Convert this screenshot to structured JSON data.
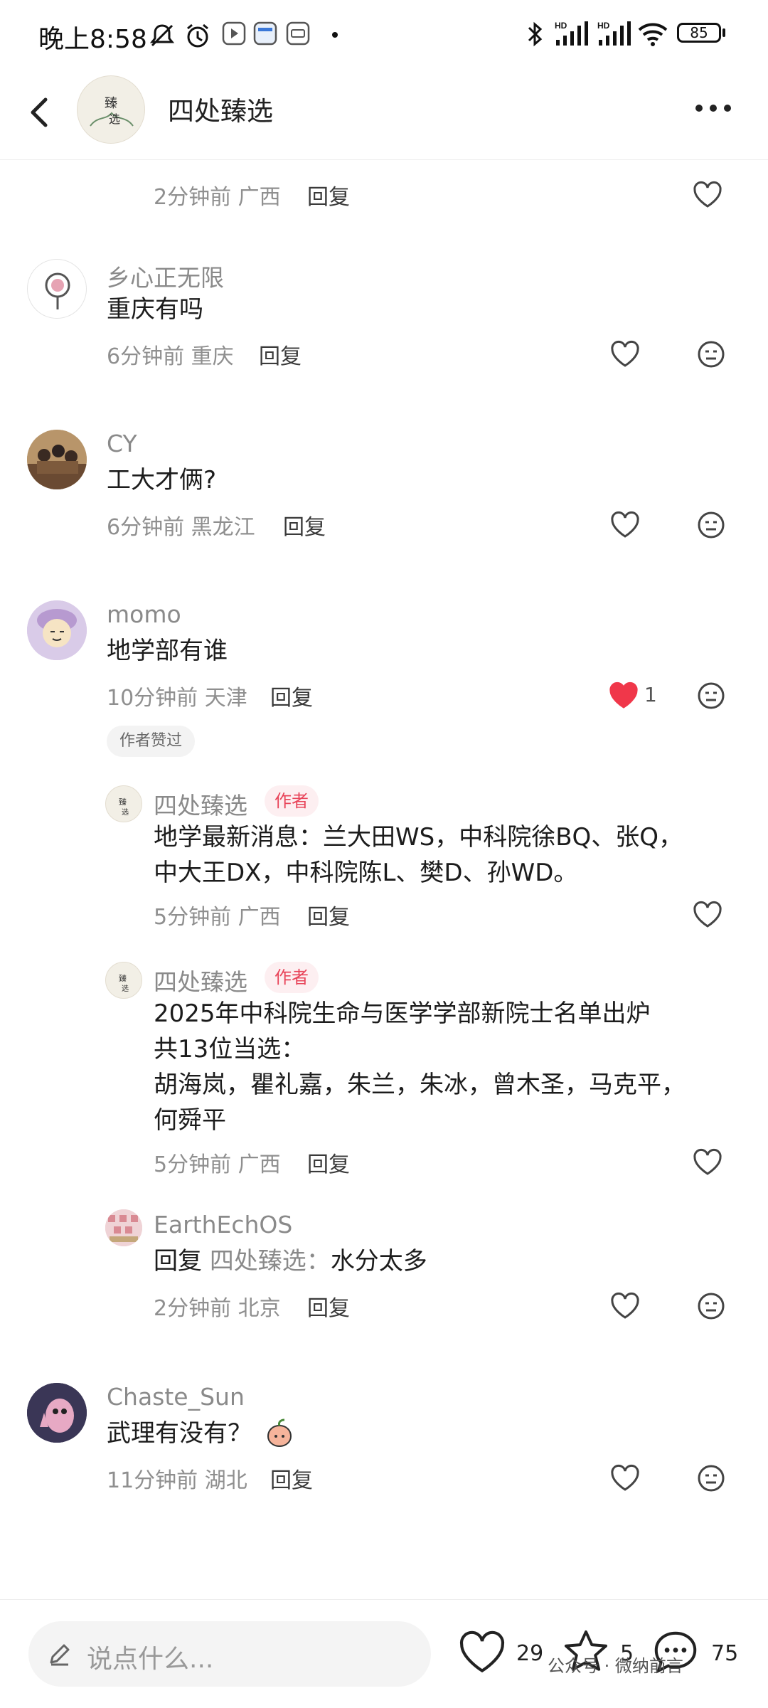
{
  "status_bar": {
    "time": "晚上8:58",
    "battery": "85",
    "icons": [
      "mute-icon",
      "alarm-icon",
      "video-app-icon",
      "app-icon",
      "app-icon-2",
      "dot-icon",
      "bluetooth-icon",
      "signal-hd-icon",
      "signal-hd-icon-2",
      "wifi-icon",
      "battery-icon"
    ]
  },
  "header": {
    "title": "四处臻选",
    "avatar_text": "臻选"
  },
  "comments": [
    {
      "time": "2分钟前",
      "location": "广西",
      "reply_label": "回复"
    },
    {
      "name": "乡心正无限",
      "text": "重庆有吗",
      "time": "6分钟前",
      "location": "重庆",
      "reply_label": "回复"
    },
    {
      "name": "CY",
      "text": "工大才俩?",
      "time": "6分钟前",
      "location": "黑龙江",
      "reply_label": "回复"
    },
    {
      "name": "momo",
      "text": "地学部有谁",
      "time": "10分钟前",
      "location": "天津",
      "reply_label": "回复",
      "likes": "1",
      "author_liked": "作者赞过",
      "replies": [
        {
          "name": "四处臻选",
          "badge": "作者",
          "lines": [
            "地学最新消息：兰大田WS，中科院徐BQ、张Q，",
            "中大王DX，中科院陈L、樊D、孙WD。"
          ],
          "time": "5分钟前",
          "location": "广西",
          "reply_label": "回复"
        },
        {
          "name": "四处臻选",
          "badge": "作者",
          "lines": [
            "2025年中科院生命与医学学部新院士名单出炉",
            "共13位当选：",
            "胡海岚，瞿礼嘉，朱兰，朱冰，曾木圣，马克平，",
            "何舜平"
          ],
          "time": "5分钟前",
          "location": "广西",
          "reply_label": "回复"
        },
        {
          "name": "EarthEchOS",
          "reply_prefix": "回复",
          "reply_to": "四处臻选：",
          "text": "水分太多",
          "time": "2分钟前",
          "location": "北京",
          "reply_label": "回复"
        }
      ]
    },
    {
      "name": "Chaste_Sun",
      "text": "武理有没有？",
      "time": "11分钟前",
      "location": "湖北",
      "reply_label": "回复"
    }
  ],
  "bottom_bar": {
    "placeholder": "说点什么...",
    "likes": "29",
    "favorites": "5",
    "comments": "75"
  },
  "watermark": "公众号 · 微纳前言",
  "colors": {
    "liked_heart": "#f0374a",
    "author_badge": "#e8455a"
  }
}
